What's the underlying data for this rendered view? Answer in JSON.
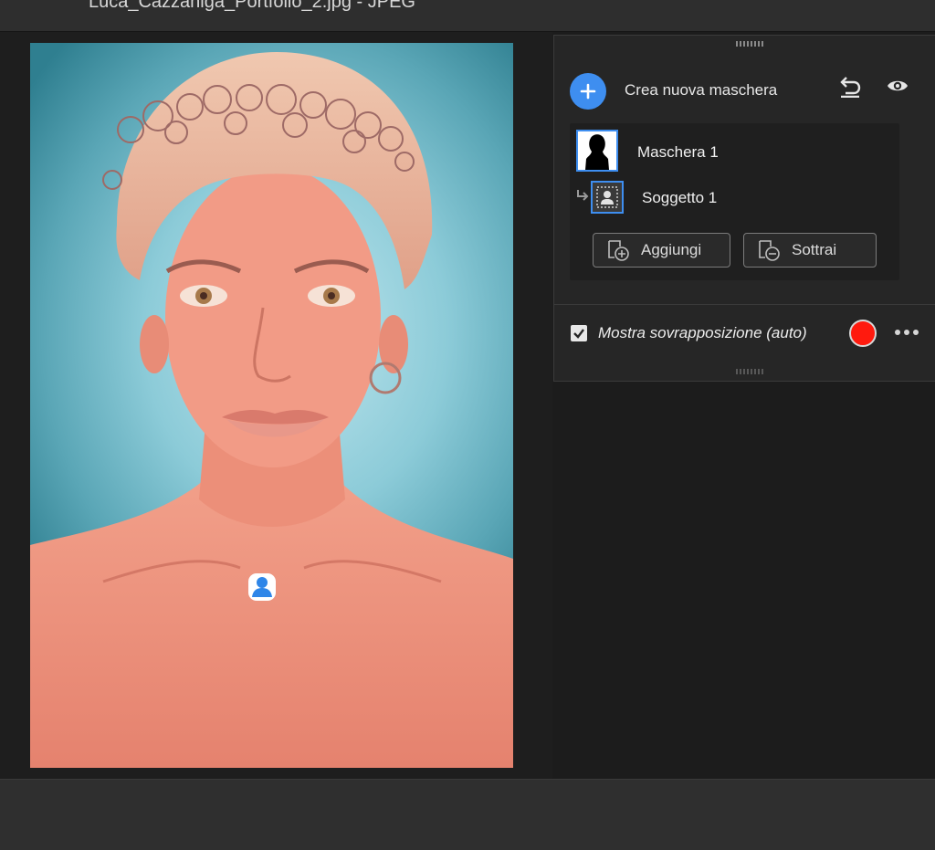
{
  "window": {
    "title": "Luca_Cazzaniga_Portfolio_2.jpg  -  JPEG"
  },
  "masks_panel": {
    "create_mask_label": "Crea nuova maschera",
    "masks": [
      {
        "label": "Maschera 1"
      }
    ],
    "components": [
      {
        "label": "Soggetto 1"
      }
    ],
    "add_label": "Aggiungi",
    "subtract_label": "Sottrai",
    "overlay": {
      "checked": true,
      "label": "Mostra sovrapposizione (auto)",
      "color": "#ff1a0e"
    }
  },
  "colors": {
    "accent": "#3e8ef0",
    "overlay_tint": "#f07e6c"
  },
  "icons": {
    "create": "plus-icon",
    "reset": "undo-icon",
    "visibility": "eye-icon",
    "add": "add-mask-icon",
    "subtract": "subtract-mask-icon",
    "more": "ellipsis-icon",
    "subject": "person-icon"
  }
}
